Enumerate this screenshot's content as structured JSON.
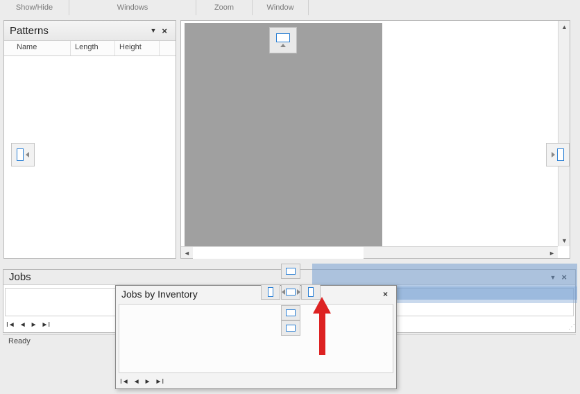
{
  "ribbon": {
    "group1": "Show/Hide",
    "group2": "Windows",
    "group3": "Zoom",
    "group4": "Window"
  },
  "patterns": {
    "title": "Patterns",
    "cols": {
      "name": "Name",
      "length": "Length",
      "height": "Height"
    }
  },
  "jobs": {
    "title": "Jobs"
  },
  "float": {
    "title": "Jobs by Inventory"
  },
  "status": {
    "text": "Ready"
  },
  "nav_glyphs": {
    "first": "I◄",
    "prev": "◄",
    "next": "►",
    "last": "►I"
  }
}
